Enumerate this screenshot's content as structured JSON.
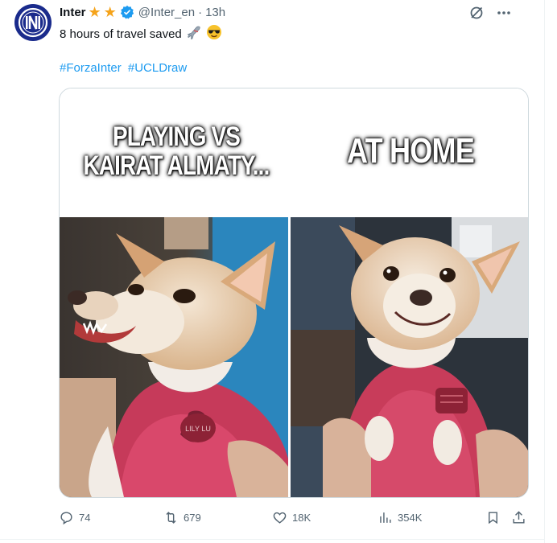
{
  "tweet": {
    "author_name": "Inter",
    "stars": [
      "★",
      "★"
    ],
    "handle": "@Inter_en",
    "separator": "·",
    "time": "13h",
    "text": "8 hours of travel saved",
    "emojis": [
      "airplane",
      "smiling-face-with-sunglasses"
    ],
    "hashtags": [
      "#ForzaInter",
      "#UCLDraw"
    ]
  },
  "media": {
    "caption_left_line1": "PLAYING VS",
    "caption_left_line2": "KAIRAT ALMATY...",
    "caption_right": "AT HOME",
    "left_photo": "angry snarling chihuahua in pink sweater",
    "right_photo": "happy smiling chihuahua in pink sweater",
    "tag_text": "LILY LU"
  },
  "actions": {
    "replies": "74",
    "reposts": "679",
    "likes": "18K",
    "views": "354K"
  },
  "colors": {
    "link": "#1d9bf0",
    "muted": "#536471",
    "verified": "#1d9bf0",
    "star": "#f5a31a",
    "avatar_bg": "#1a2b8c"
  }
}
